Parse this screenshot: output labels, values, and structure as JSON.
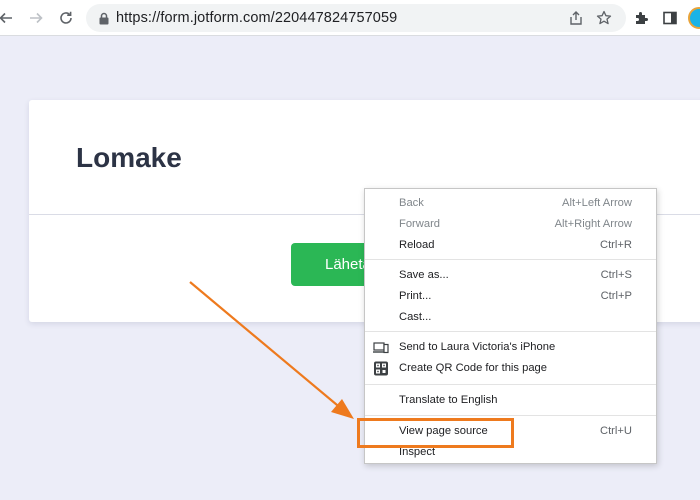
{
  "browser": {
    "url": "https://form.jotform.com/220447824757059",
    "avatar_color": "#1ab3e6"
  },
  "page": {
    "title": "Lomake",
    "submit_label": "Lähetä",
    "submit_color": "#2bb755"
  },
  "context_menu": {
    "back": {
      "label": "Back",
      "shortcut": "Alt+Left Arrow"
    },
    "forward": {
      "label": "Forward",
      "shortcut": "Alt+Right Arrow"
    },
    "reload": {
      "label": "Reload",
      "shortcut": "Ctrl+R"
    },
    "save_as": {
      "label": "Save as...",
      "shortcut": "Ctrl+S"
    },
    "print": {
      "label": "Print...",
      "shortcut": "Ctrl+P"
    },
    "cast": {
      "label": "Cast..."
    },
    "send_to_device": {
      "label": "Send to Laura Victoria's iPhone",
      "icon": "send-to-device-icon"
    },
    "qr_code": {
      "label": "Create QR Code for this page",
      "icon": "qr-code-icon"
    },
    "translate": {
      "label": "Translate to English"
    },
    "view_source": {
      "label": "View page source",
      "shortcut": "Ctrl+U"
    },
    "inspect": {
      "label": "Inspect"
    }
  },
  "annotation": {
    "color": "#ee7a1e"
  }
}
